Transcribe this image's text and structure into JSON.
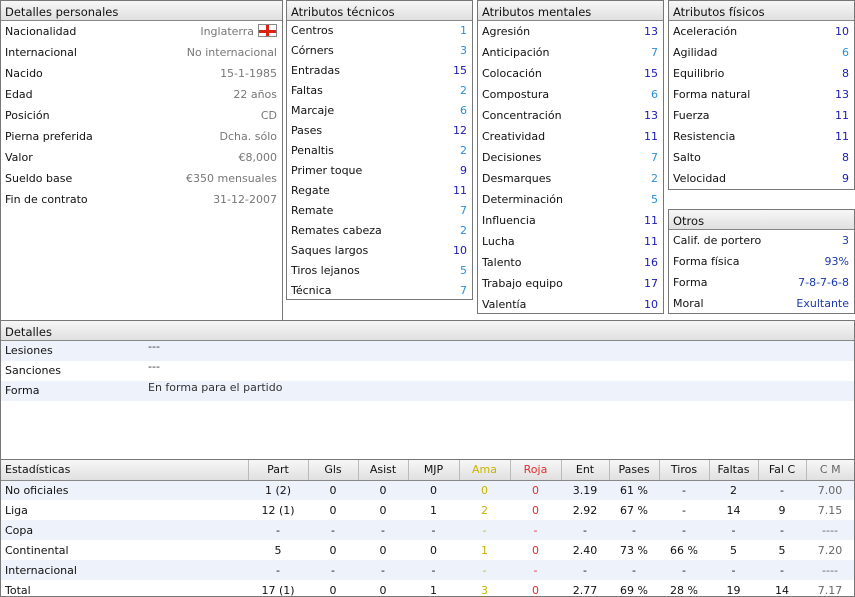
{
  "personal": {
    "title": "Detalles personales",
    "rows": [
      {
        "label": "Nacionalidad",
        "value": "Inglaterra"
      },
      {
        "label": "Internacional",
        "value": "No internacional"
      },
      {
        "label": "Nacido",
        "value": "15-1-1985"
      },
      {
        "label": "Edad",
        "value": "22 años"
      },
      {
        "label": "Posición",
        "value": "CD"
      },
      {
        "label": "Pierna preferida",
        "value": "Dcha. sólo"
      },
      {
        "label": "Valor",
        "value": "€8,000"
      },
      {
        "label": "Sueldo base",
        "value": "€350 mensuales"
      },
      {
        "label": "Fin de contrato",
        "value": "31-12-2007"
      }
    ]
  },
  "technical": {
    "title": "Atributos técnicos",
    "rows": [
      {
        "label": "Centros",
        "value": "1"
      },
      {
        "label": "Córners",
        "value": "3"
      },
      {
        "label": "Entradas",
        "value": "15"
      },
      {
        "label": "Faltas",
        "value": "2"
      },
      {
        "label": "Marcaje",
        "value": "6"
      },
      {
        "label": "Pases",
        "value": "12"
      },
      {
        "label": "Penaltis",
        "value": "2"
      },
      {
        "label": "Primer toque",
        "value": "9"
      },
      {
        "label": "Regate",
        "value": "11"
      },
      {
        "label": "Remate",
        "value": "7"
      },
      {
        "label": "Remates cabeza",
        "value": "2"
      },
      {
        "label": "Saques largos",
        "value": "10"
      },
      {
        "label": "Tiros lejanos",
        "value": "5"
      },
      {
        "label": "Técnica",
        "value": "7"
      }
    ]
  },
  "mental": {
    "title": "Atributos mentales",
    "rows": [
      {
        "label": "Agresión",
        "value": "13"
      },
      {
        "label": "Anticipación",
        "value": "7"
      },
      {
        "label": "Colocación",
        "value": "15"
      },
      {
        "label": "Compostura",
        "value": "6"
      },
      {
        "label": "Concentración",
        "value": "13"
      },
      {
        "label": "Creatividad",
        "value": "11"
      },
      {
        "label": "Decisiones",
        "value": "7"
      },
      {
        "label": "Desmarques",
        "value": "2"
      },
      {
        "label": "Determinación",
        "value": "5"
      },
      {
        "label": "Influencia",
        "value": "11"
      },
      {
        "label": "Lucha",
        "value": "11"
      },
      {
        "label": "Talento",
        "value": "16"
      },
      {
        "label": "Trabajo equipo",
        "value": "17"
      },
      {
        "label": "Valentía",
        "value": "10"
      }
    ]
  },
  "physical": {
    "title": "Atributos físicos",
    "rows": [
      {
        "label": "Aceleración",
        "value": "10"
      },
      {
        "label": "Agilidad",
        "value": "6"
      },
      {
        "label": "Equilibrio",
        "value": "8"
      },
      {
        "label": "Forma natural",
        "value": "13"
      },
      {
        "label": "Fuerza",
        "value": "11"
      },
      {
        "label": "Resistencia",
        "value": "11"
      },
      {
        "label": "Salto",
        "value": "8"
      },
      {
        "label": "Velocidad",
        "value": "9"
      }
    ]
  },
  "others": {
    "title": "Otros",
    "rows": [
      {
        "label": "Calif. de portero",
        "value": "3"
      },
      {
        "label": "Forma física",
        "value": "93%"
      },
      {
        "label": "Forma",
        "value": "7-8-7-6-8"
      },
      {
        "label": "Moral",
        "value": "Exultante"
      }
    ]
  },
  "details": {
    "title": "Detalles",
    "rows": [
      {
        "label": "Lesiones",
        "value": "---"
      },
      {
        "label": "Sanciones",
        "value": "---"
      },
      {
        "label": "Forma",
        "value": "En forma para el partido"
      }
    ]
  },
  "stats": {
    "headers": [
      "Estadísticas",
      "Part",
      "Gls",
      "Asist",
      "MJP",
      "Ama",
      "Roja",
      "Ent",
      "Pases",
      "Tiros",
      "Faltas",
      "Fal C",
      "C M"
    ],
    "rows": [
      [
        "No oficiales",
        "1 (2)",
        "0",
        "0",
        "0",
        "0",
        "0",
        "3.19",
        "61 %",
        "-",
        "2",
        "-",
        "7.00"
      ],
      [
        "Liga",
        "12 (1)",
        "0",
        "0",
        "1",
        "2",
        "0",
        "2.92",
        "67 %",
        "-",
        "14",
        "9",
        "7.15"
      ],
      [
        "Copa",
        "-",
        "-",
        "-",
        "-",
        "-",
        "-",
        "-",
        "-",
        "-",
        "-",
        "-",
        "----"
      ],
      [
        "Continental",
        "5",
        "0",
        "0",
        "0",
        "1",
        "0",
        "2.40",
        "73 %",
        "66 %",
        "5",
        "5",
        "7.20"
      ],
      [
        "Internacional",
        "-",
        "-",
        "-",
        "-",
        "-",
        "-",
        "-",
        "-",
        "-",
        "-",
        "-",
        "----"
      ],
      [
        "Total",
        "17 (1)",
        "0",
        "0",
        "1",
        "3",
        "0",
        "2.77",
        "69 %",
        "28 %",
        "19",
        "14",
        "7.17"
      ]
    ]
  }
}
